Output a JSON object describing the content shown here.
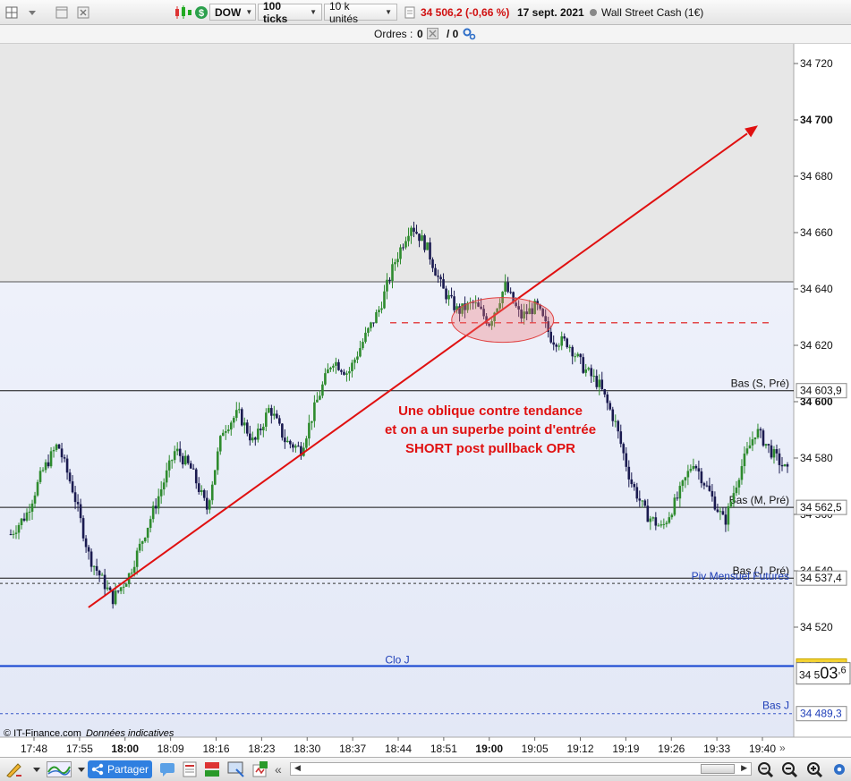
{
  "toolbar": {
    "symbol": "DOW",
    "period": "100 ticks",
    "units": "10 k unités",
    "quote": "34 506,2 (-0,66 %)",
    "date": "17 sept. 2021",
    "instrument": "Wall Street Cash (1€)"
  },
  "orders": {
    "label": "Ordres :",
    "count_a": "0",
    "count_b": "/ 0"
  },
  "yaxis": {
    "labels": [
      "34 720",
      "34 700",
      "34 680",
      "34 660",
      "34 640",
      "34 620",
      "34 600",
      "34 580",
      "34 560",
      "34 540",
      "34 520"
    ],
    "values": [
      34720,
      34700,
      34680,
      34660,
      34640,
      34620,
      34600,
      34580,
      34560,
      34540,
      34520
    ],
    "bold": [
      "34 700",
      "34 600"
    ]
  },
  "xaxis": {
    "labels": [
      "17:48",
      "17:55",
      "18:00",
      "18:09",
      "18:16",
      "18:23",
      "18:30",
      "18:37",
      "18:44",
      "18:51",
      "19:00",
      "19:05",
      "19:12",
      "19:19",
      "19:26",
      "19:33",
      "19:40"
    ],
    "bold": [
      "18:00",
      "19:00"
    ]
  },
  "levels": [
    {
      "name": "Bas (S, Pré)",
      "value_label": "34 603,9",
      "value": 34603.9
    },
    {
      "name": "Bas (M, Pré)",
      "value_label": "34 562,5",
      "value": 34562.5
    },
    {
      "name": "Bas (J, Pré)",
      "value_label": "34 537,4",
      "value": 34537.4
    },
    {
      "name": "Piv Mensuel Futures",
      "value": 34535.5
    },
    {
      "name": "Clo J",
      "value_label": "34 506,2",
      "value": 34506.2
    },
    {
      "name": "Bas J",
      "value_label": "34 489,3",
      "value": 34489.3
    }
  ],
  "current_price": {
    "prefix": "34 5",
    "big": "03",
    "suffix": ",6",
    "value": 34503.6
  },
  "annotation": {
    "lines": [
      "Une oblique contre tendance",
      "et on a un superbe point d'entrée",
      "SHORT post pullback OPR"
    ],
    "color": "#e01010"
  },
  "footer": {
    "source": "© IT-Finance.com",
    "note": "Données indicatives"
  },
  "bottom": {
    "share_label": "Partager"
  },
  "colors": {
    "bull": "#2e8b2e",
    "bear": "#1a1a50",
    "accent": "#2f7fe0",
    "clo_line": "#1040d0"
  },
  "chart_data": {
    "type": "candlestick",
    "ylim": [
      34482,
      34732
    ],
    "x": [
      "17:48",
      "17:55",
      "18:00",
      "18:09",
      "18:16",
      "18:23",
      "18:30",
      "18:37",
      "18:44",
      "18:51",
      "19:00",
      "19:05",
      "19:12",
      "19:19",
      "19:26",
      "19:33",
      "19:40"
    ],
    "close_path": [
      [
        0,
        34553
      ],
      [
        2,
        34560
      ],
      [
        4,
        34575
      ],
      [
        6,
        34585
      ],
      [
        8,
        34568
      ],
      [
        10,
        34545
      ],
      [
        13,
        34530
      ],
      [
        15,
        34538
      ],
      [
        18,
        34560
      ],
      [
        21,
        34583
      ],
      [
        23,
        34576
      ],
      [
        25,
        34562
      ],
      [
        27,
        34590
      ],
      [
        29,
        34596
      ],
      [
        31,
        34585
      ],
      [
        33,
        34598
      ],
      [
        35,
        34586
      ],
      [
        37,
        34583
      ],
      [
        39,
        34600
      ],
      [
        41,
        34615
      ],
      [
        43,
        34610
      ],
      [
        45,
        34622
      ],
      [
        47,
        34633
      ],
      [
        49,
        34650
      ],
      [
        51,
        34663
      ],
      [
        53,
        34655
      ],
      [
        55,
        34640
      ],
      [
        57,
        34632
      ],
      [
        59,
        34635
      ],
      [
        61,
        34628
      ],
      [
        63,
        34641
      ],
      [
        65,
        34630
      ],
      [
        67,
        34634
      ],
      [
        69,
        34622
      ],
      [
        71,
        34621
      ],
      [
        73,
        34612
      ],
      [
        75,
        34606
      ],
      [
        77,
        34593
      ],
      [
        79,
        34572
      ],
      [
        81,
        34560
      ],
      [
        83,
        34555
      ],
      [
        85,
        34566
      ],
      [
        87,
        34579
      ],
      [
        89,
        34568
      ],
      [
        91,
        34557
      ],
      [
        93,
        34576
      ],
      [
        95,
        34590
      ],
      [
        97,
        34582
      ],
      [
        99,
        34575
      ]
    ],
    "trendline": {
      "from": [
        "17:55",
        34527
      ],
      "to": [
        "19:40",
        34698
      ]
    },
    "entry_level": 34628,
    "entry_zone": {
      "time": "19:00",
      "price": 34629
    }
  }
}
